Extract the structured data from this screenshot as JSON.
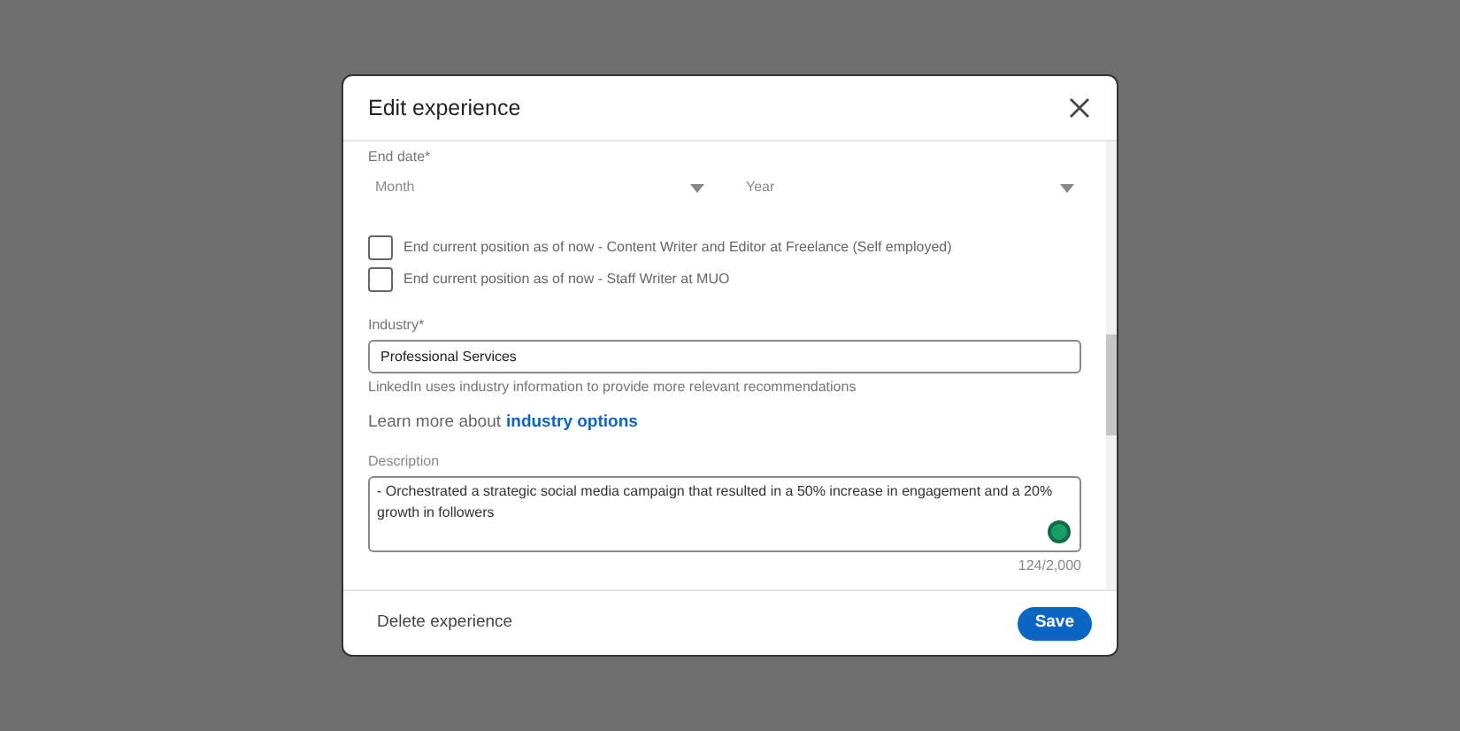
{
  "dialog": {
    "title": "Edit experience",
    "end_date": {
      "label": "End date*",
      "disabled": true,
      "selects": [
        {
          "placeholder": "Month"
        },
        {
          "placeholder": "Year"
        }
      ]
    },
    "checkboxes": [
      {
        "label": "End current position as of now - Content Writer and Editor at Freelance (Self employed)",
        "checked": false
      },
      {
        "label": "End current position as of now - Staff Writer at MUO",
        "checked": false
      }
    ],
    "industry": {
      "label": "Industry*",
      "value": "Professional Services",
      "hint": "LinkedIn uses industry information to provide more relevant recommendations",
      "learn_more": "Learn more about",
      "link": "industry options"
    },
    "description": {
      "label": "Description",
      "value": "- Orchestrated a strategic social media campaign that resulted in a 50% increase in engagement and a 20% growth in followers",
      "counter": "124/2,000"
    },
    "footer": {
      "delete": "Delete experience",
      "save": "Save"
    }
  }
}
